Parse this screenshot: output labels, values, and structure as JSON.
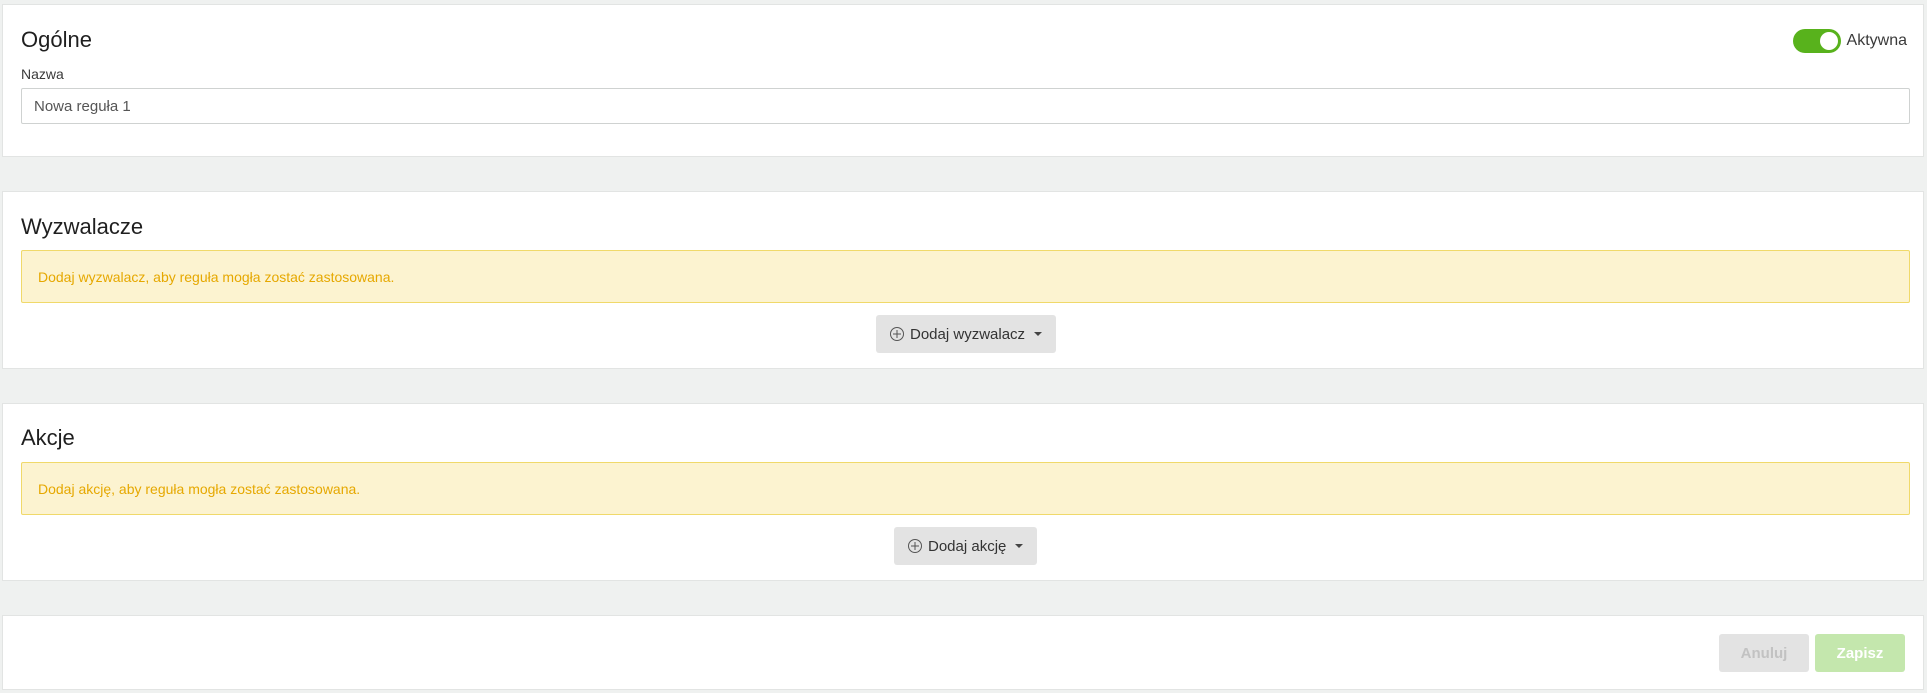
{
  "general": {
    "title": "Ogólne",
    "active_toggle": {
      "label": "Aktywna",
      "on": true
    },
    "name_label": "Nazwa",
    "name_value": "Nowa reguła 1"
  },
  "triggers": {
    "title": "Wyzwalacze",
    "alert_text": "Dodaj wyzwalacz, aby reguła mogła zostać zastosowana.",
    "add_button_label": "Dodaj wyzwalacz"
  },
  "actions": {
    "title": "Akcje",
    "alert_text": "Dodaj akcję, aby reguła mogła zostać zastosowana.",
    "add_button_label": "Dodaj akcję"
  },
  "footer": {
    "cancel_label": "Anuluj",
    "save_label": "Zapisz"
  },
  "colors": {
    "accent": "#58b21c",
    "alert_bg": "#fcf3d0",
    "alert_text": "#e6a800"
  },
  "icons": {
    "add": "plus-circle-icon",
    "dropdown": "caret-down-icon"
  }
}
